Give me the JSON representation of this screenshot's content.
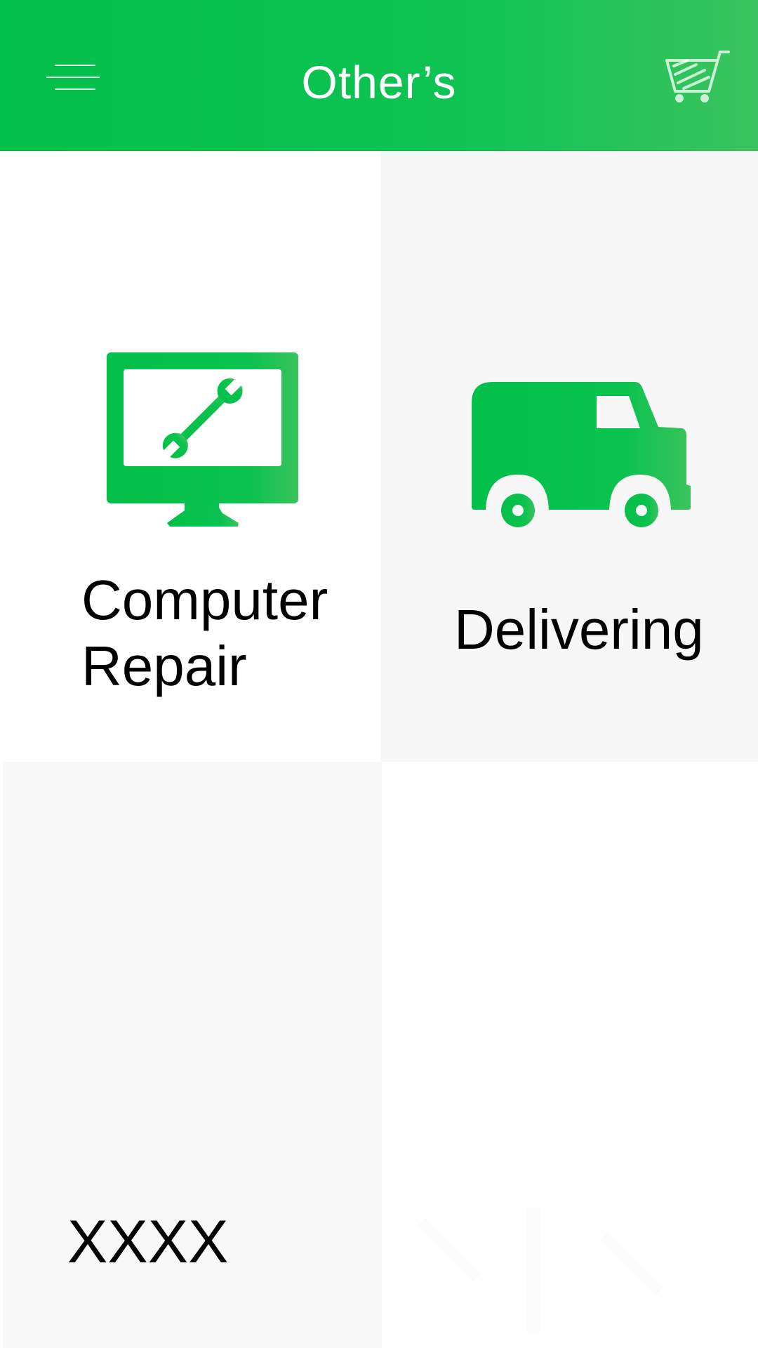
{
  "header": {
    "title": "Other’s",
    "menu_icon": "hamburger-menu-icon",
    "cart_icon": "shopping-cart-icon"
  },
  "services": [
    {
      "label_line1": "Computer",
      "label_line2": "Repair",
      "icon": "monitor-wrench-icon"
    },
    {
      "label": "Delivering",
      "icon": "delivery-van-icon"
    },
    {
      "label": "XXXX"
    }
  ],
  "colors": {
    "accent": "#03c04a",
    "accent_light": "#3ac35e",
    "tile_gray": "#f7f7f7",
    "text": "#000000"
  }
}
